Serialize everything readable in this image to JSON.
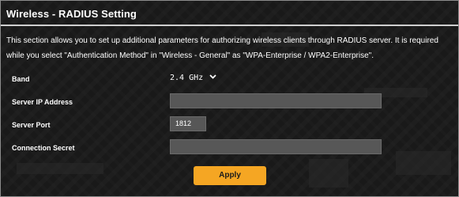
{
  "panel": {
    "title": "Wireless - RADIUS Setting",
    "description": "This section allows you to set up additional parameters for authorizing wireless clients through RADIUS server. It is required while you select \"Authentication Method\" in \"Wireless - General\" as \"WPA-Enterprise / WPA2-Enterprise\"."
  },
  "form": {
    "band": {
      "label": "Band",
      "selected": "2.4 GHz",
      "chevron": "⌄"
    },
    "server_ip": {
      "label": "Server IP Address",
      "value": ""
    },
    "server_port": {
      "label": "Server Port",
      "value": "1812"
    },
    "connection_secret": {
      "label": "Connection Secret",
      "value": ""
    }
  },
  "apply_button": {
    "label": "Apply"
  },
  "colors": {
    "background": "#191919",
    "input_fill": "#575757",
    "accent": "#f5a623"
  },
  "icons": {
    "band_dropdown": "chevron-down-icon"
  }
}
